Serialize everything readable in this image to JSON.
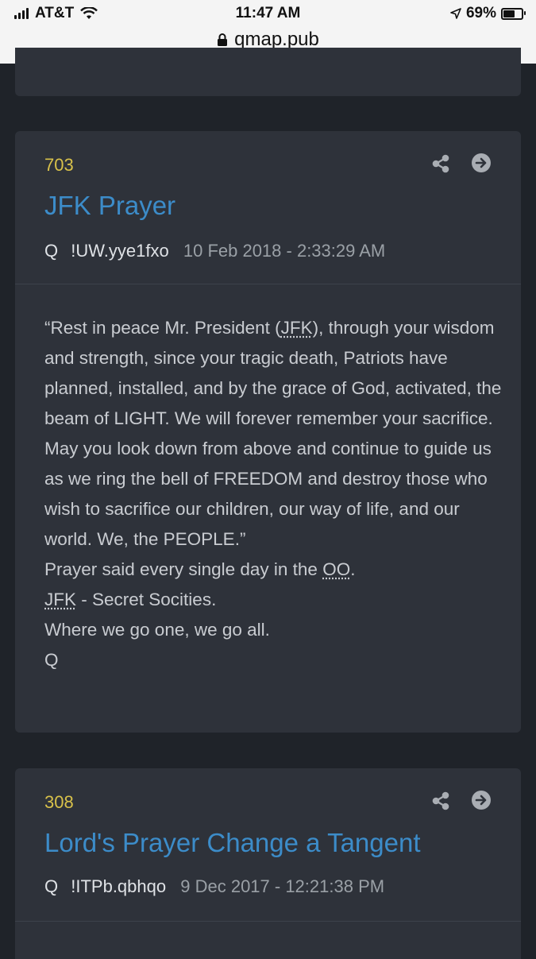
{
  "status_bar": {
    "carrier": "AT&T",
    "time": "11:47 AM",
    "battery_percent": "69%",
    "battery_level": 0.69,
    "url": "qmap.pub"
  },
  "posts": [
    {
      "number": "703",
      "title": "JFK Prayer",
      "author": "Q",
      "trip": "!UW.yye1fxo",
      "date": "10 Feb 2018 - 2:33:29 AM",
      "body": {
        "line1_pre": "“Rest in peace Mr. President (",
        "line1_abbr": "JFK",
        "line1_post": "), through your wisdom and strength, since your tragic death, Patriots have planned, installed, and by the grace of God, activated, the beam of LIGHT. We will forever remember your sacrifice. May you look down from above and continue to guide us as we ring the bell of FREEDOM and destroy those who wish to sacrifice our children, our way of life, and our world. We, the PEOPLE.”",
        "line2_pre": "Prayer said every single day in the ",
        "line2_abbr": "OO",
        "line2_post": ".",
        "line3_abbr": "JFK",
        "line3_post": " - Secret Socities.",
        "line4": "Where we go one, we go all.",
        "line5": "Q"
      }
    },
    {
      "number": "308",
      "title": "Lord's Prayer Change a Tangent",
      "author": "Q",
      "trip": "!ITPb.qbhqo",
      "date": "9 Dec 2017 - 12:21:38 PM"
    }
  ]
}
